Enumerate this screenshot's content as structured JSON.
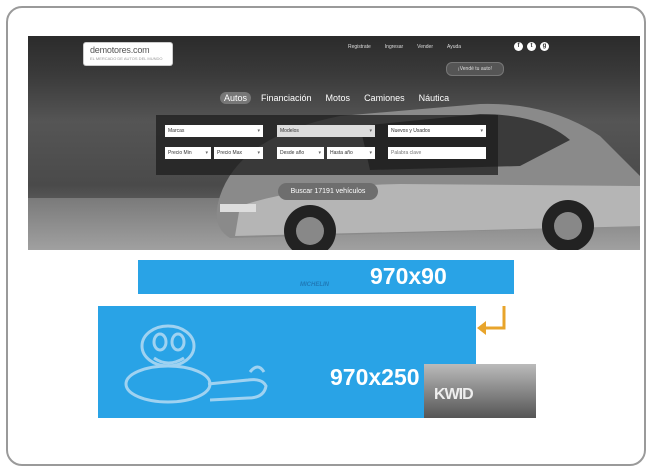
{
  "logo": {
    "name": "demotores.com",
    "tagline": "EL MERCADO DE AUTOS DEL MUNDO"
  },
  "nav": {
    "items": [
      "Registrate",
      "Ingresar",
      "Vender",
      "Ayuda"
    ]
  },
  "social": [
    "f",
    "t",
    "g"
  ],
  "sell_button": "¡Vendé tu auto!",
  "tabs": [
    "Autos",
    "Financiación",
    "Motos",
    "Camiones",
    "Náutica"
  ],
  "search": {
    "brand": "Marcas",
    "model": "Modelos",
    "condition": "Nuevos y Usados",
    "price_min": "Precio Min",
    "price_max": "Precio Max",
    "year_from": "Desde año",
    "year_to": "Hasta año",
    "keyword_placeholder": "Palabra clave",
    "button": "Buscar 17191 vehículos"
  },
  "ads": {
    "leaderboard_size": "970x90",
    "billboard_size": "970x250",
    "brand": "MICHELIN",
    "side_text": "KWID"
  },
  "colors": {
    "ad_blue": "#29a3e6",
    "arrow": "#e8a42b",
    "hero_dark": "#2b2b2b"
  }
}
